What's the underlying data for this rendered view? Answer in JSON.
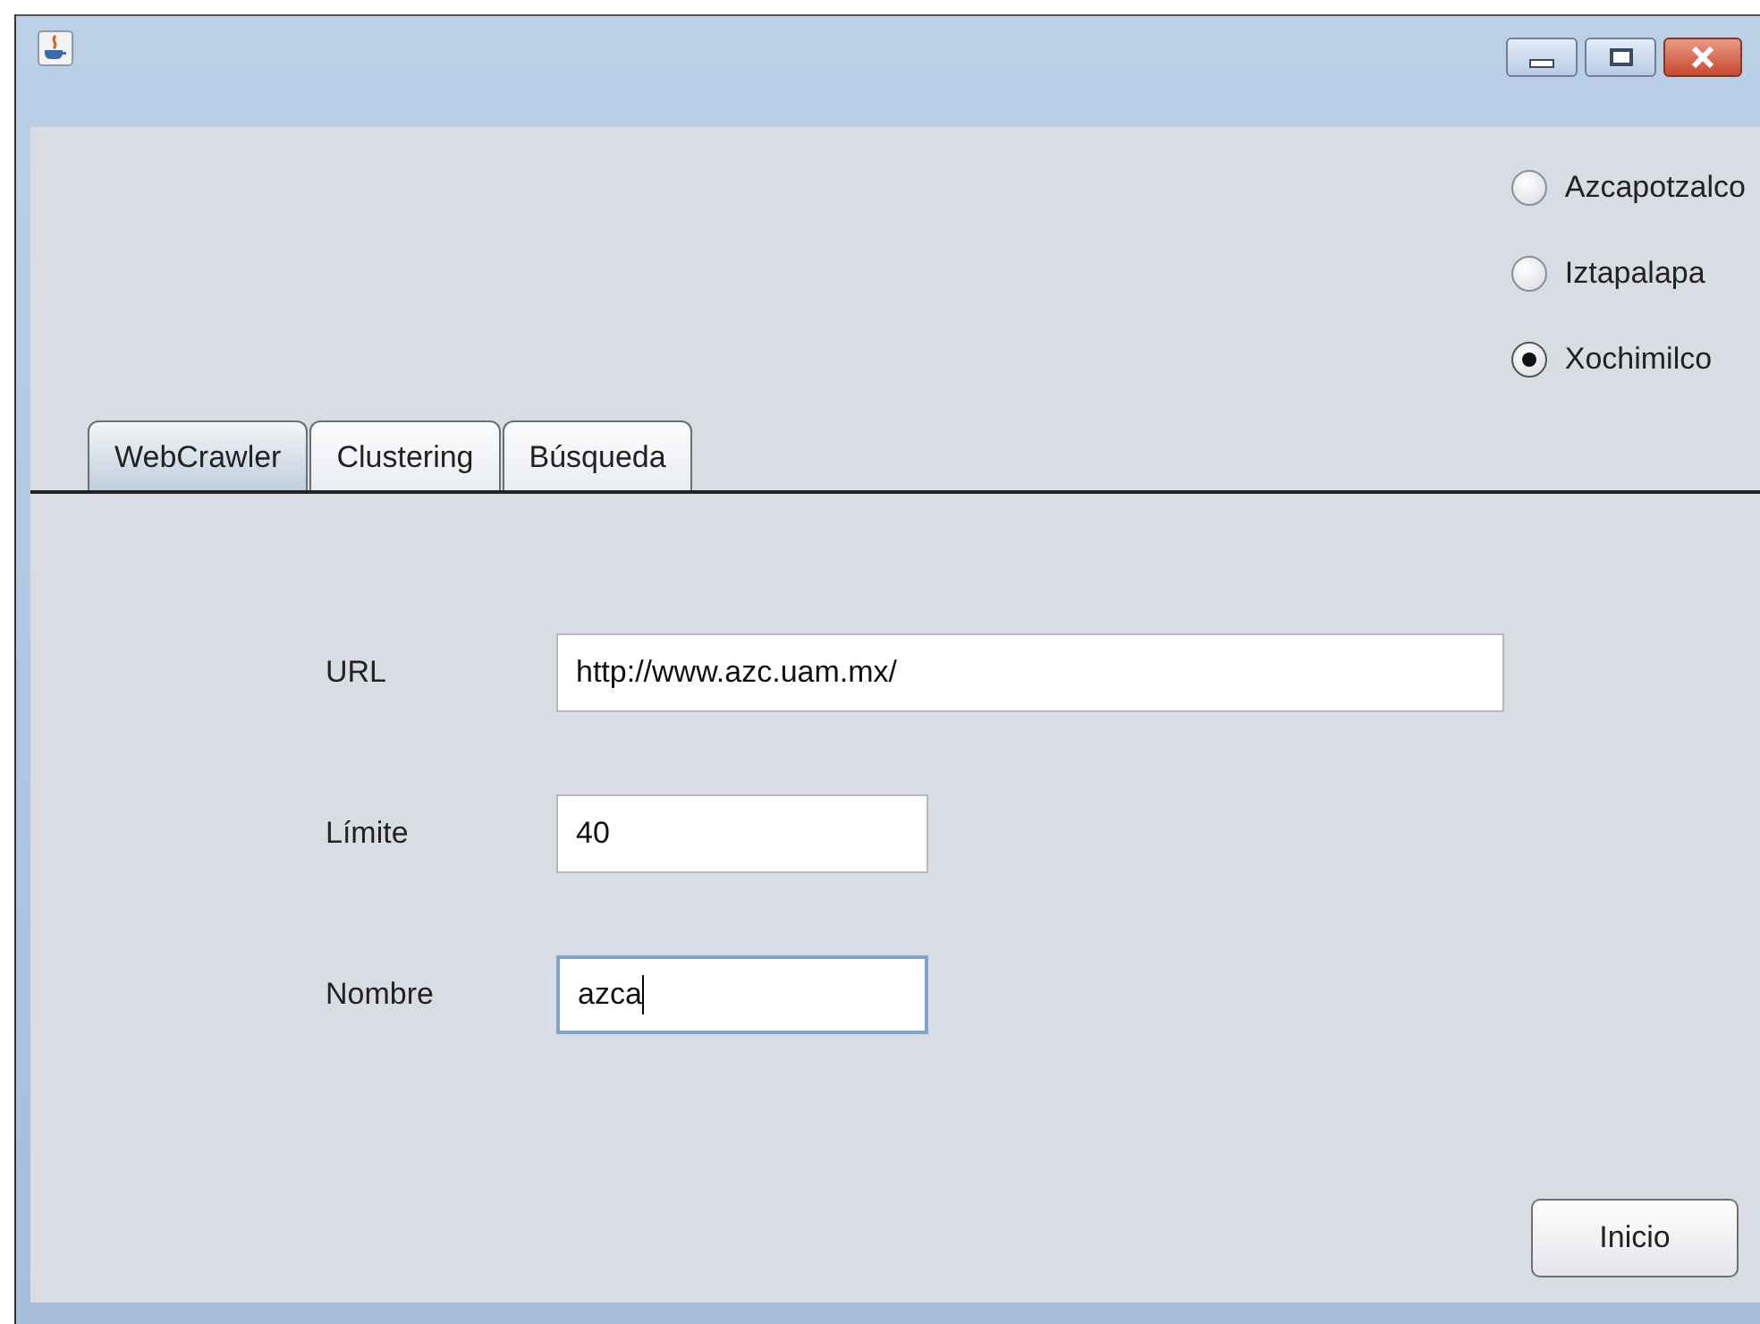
{
  "radios": [
    {
      "label": "Azcapotzalco",
      "selected": false
    },
    {
      "label": "Iztapalapa",
      "selected": false
    },
    {
      "label": "Xochimilco",
      "selected": true
    }
  ],
  "tabs": [
    {
      "label": "WebCrawler",
      "selected": true
    },
    {
      "label": "Clustering",
      "selected": false
    },
    {
      "label": "Búsqueda",
      "selected": false
    }
  ],
  "fields": [
    {
      "label": "URL",
      "value": "http://www.azc.uam.mx/",
      "kind": "wide",
      "focused": false
    },
    {
      "label": "Límite",
      "value": "40",
      "kind": "short",
      "focused": false
    },
    {
      "label": "Nombre",
      "value": "azca",
      "kind": "short",
      "focused": true
    }
  ],
  "buttons": [
    "Inicio"
  ]
}
